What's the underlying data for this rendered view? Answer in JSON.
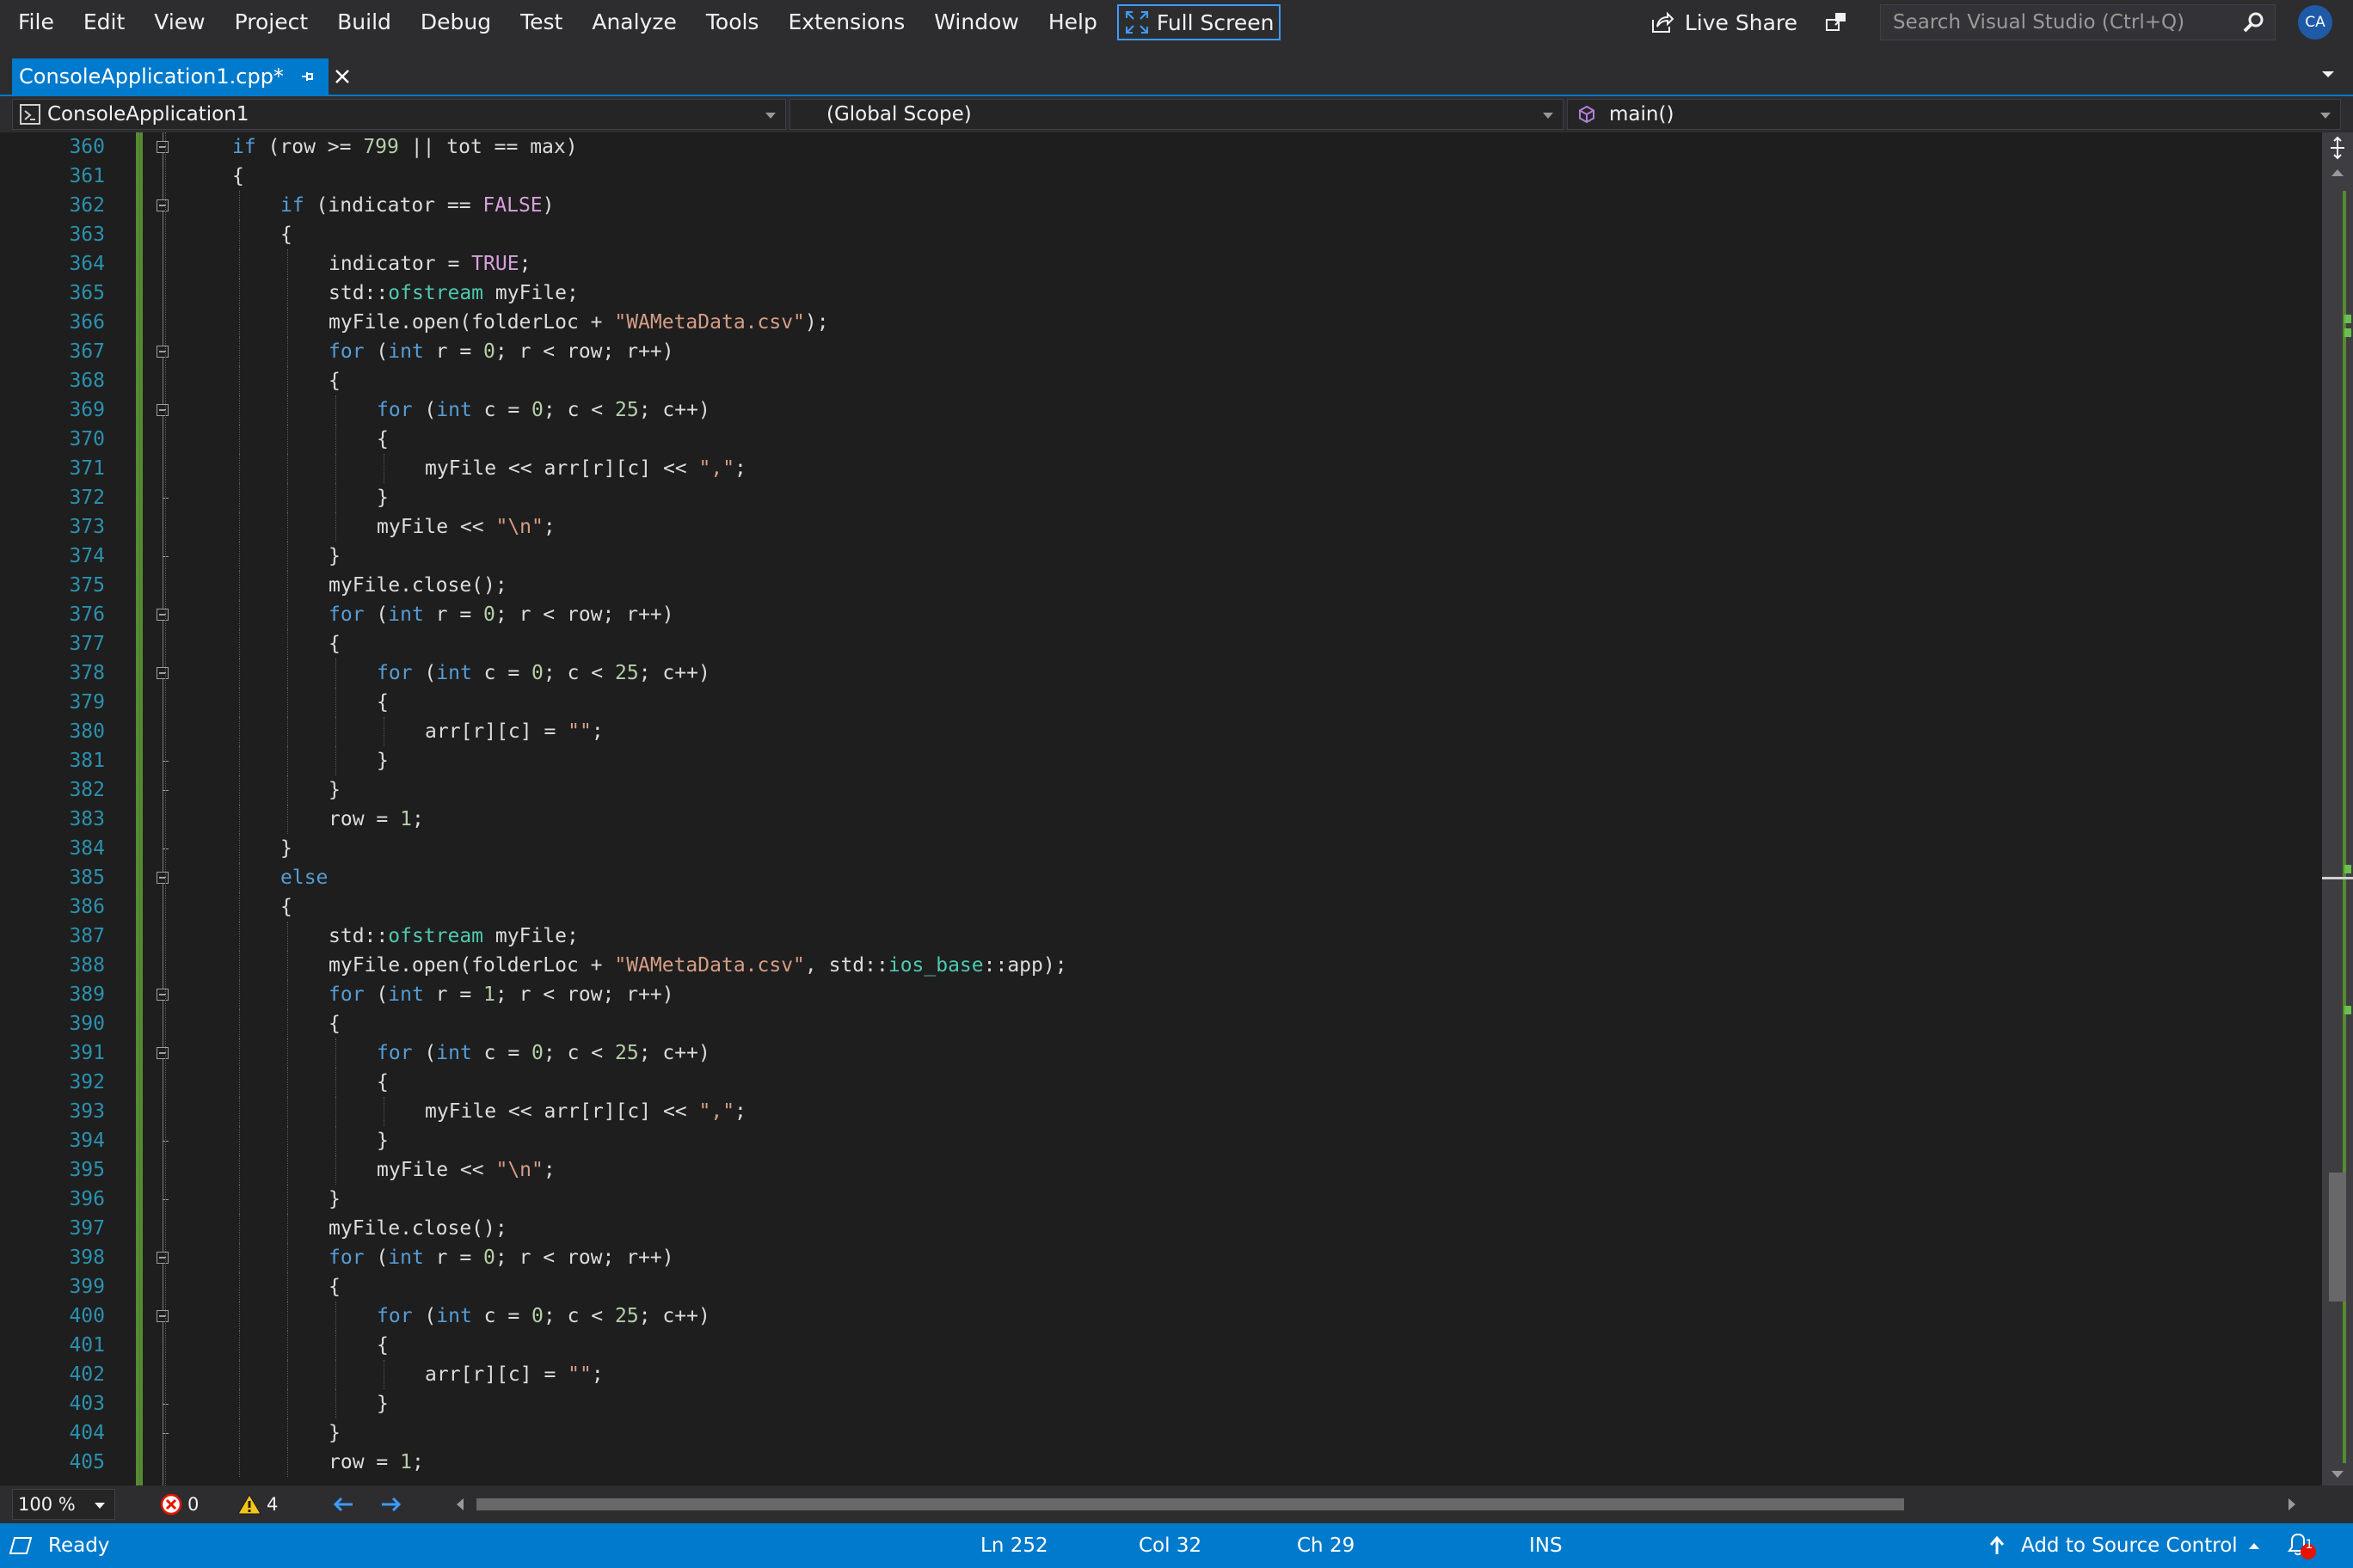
{
  "menu": {
    "items": [
      "File",
      "Edit",
      "View",
      "Project",
      "Build",
      "Debug",
      "Test",
      "Analyze",
      "Tools",
      "Extensions",
      "Window",
      "Help"
    ],
    "full_screen_label": "Full Screen"
  },
  "toolbar": {
    "live_share_label": "Live Share",
    "search_placeholder": "Search Visual Studio (Ctrl+Q)",
    "avatar_initials": "CA"
  },
  "tab": {
    "label": "ConsoleApplication1.cpp*"
  },
  "navbar": {
    "project": "ConsoleApplication1",
    "scope": "(Global Scope)",
    "member": "main()"
  },
  "editor": {
    "first_line": 360,
    "lines": [
      {
        "indent": 1,
        "tokens": [
          [
            "kw",
            "if"
          ],
          [
            "p",
            " (row >= "
          ],
          [
            "num",
            "799"
          ],
          [
            "p",
            " || tot == max)"
          ]
        ]
      },
      {
        "indent": 1,
        "tokens": [
          [
            "p",
            "{"
          ]
        ]
      },
      {
        "indent": 2,
        "tokens": [
          [
            "kw",
            "if"
          ],
          [
            "p",
            " (indicator == "
          ],
          [
            "mac",
            "FALSE"
          ],
          [
            "p",
            ")"
          ]
        ]
      },
      {
        "indent": 2,
        "tokens": [
          [
            "p",
            "{"
          ]
        ]
      },
      {
        "indent": 3,
        "tokens": [
          [
            "p",
            "indicator = "
          ],
          [
            "mac",
            "TRUE"
          ],
          [
            "p",
            ";"
          ]
        ]
      },
      {
        "indent": 3,
        "tokens": [
          [
            "p",
            "std::"
          ],
          [
            "typ",
            "ofstream"
          ],
          [
            "p",
            " myFile;"
          ]
        ]
      },
      {
        "indent": 3,
        "tokens": [
          [
            "p",
            "myFile.open(folderLoc + "
          ],
          [
            "str",
            "\"WAMetaData.csv\""
          ],
          [
            "p",
            ");"
          ]
        ]
      },
      {
        "indent": 3,
        "tokens": [
          [
            "kw",
            "for"
          ],
          [
            "p",
            " ("
          ],
          [
            "kw",
            "int"
          ],
          [
            "p",
            " r = "
          ],
          [
            "num",
            "0"
          ],
          [
            "p",
            "; r < row; r++)"
          ]
        ]
      },
      {
        "indent": 3,
        "tokens": [
          [
            "p",
            "{"
          ]
        ]
      },
      {
        "indent": 4,
        "tokens": [
          [
            "kw",
            "for"
          ],
          [
            "p",
            " ("
          ],
          [
            "kw",
            "int"
          ],
          [
            "p",
            " c = "
          ],
          [
            "num",
            "0"
          ],
          [
            "p",
            "; c < "
          ],
          [
            "num",
            "25"
          ],
          [
            "p",
            "; c++)"
          ]
        ]
      },
      {
        "indent": 4,
        "tokens": [
          [
            "p",
            "{"
          ]
        ]
      },
      {
        "indent": 5,
        "tokens": [
          [
            "p",
            "myFile << arr[r][c] << "
          ],
          [
            "str",
            "\",\""
          ],
          [
            "p",
            ";"
          ]
        ]
      },
      {
        "indent": 4,
        "tokens": [
          [
            "p",
            "}"
          ]
        ]
      },
      {
        "indent": 4,
        "tokens": [
          [
            "p",
            "myFile << "
          ],
          [
            "str",
            "\"\\n\""
          ],
          [
            "p",
            ";"
          ]
        ]
      },
      {
        "indent": 3,
        "tokens": [
          [
            "p",
            "}"
          ]
        ]
      },
      {
        "indent": 3,
        "tokens": [
          [
            "p",
            "myFile.close();"
          ]
        ]
      },
      {
        "indent": 3,
        "tokens": [
          [
            "kw",
            "for"
          ],
          [
            "p",
            " ("
          ],
          [
            "kw",
            "int"
          ],
          [
            "p",
            " r = "
          ],
          [
            "num",
            "0"
          ],
          [
            "p",
            "; r < row; r++)"
          ]
        ]
      },
      {
        "indent": 3,
        "tokens": [
          [
            "p",
            "{"
          ]
        ]
      },
      {
        "indent": 4,
        "tokens": [
          [
            "kw",
            "for"
          ],
          [
            "p",
            " ("
          ],
          [
            "kw",
            "int"
          ],
          [
            "p",
            " c = "
          ],
          [
            "num",
            "0"
          ],
          [
            "p",
            "; c < "
          ],
          [
            "num",
            "25"
          ],
          [
            "p",
            "; c++)"
          ]
        ]
      },
      {
        "indent": 4,
        "tokens": [
          [
            "p",
            "{"
          ]
        ]
      },
      {
        "indent": 5,
        "tokens": [
          [
            "p",
            "arr[r][c] = "
          ],
          [
            "str",
            "\"\""
          ],
          [
            "p",
            ";"
          ]
        ]
      },
      {
        "indent": 4,
        "tokens": [
          [
            "p",
            "}"
          ]
        ]
      },
      {
        "indent": 3,
        "tokens": [
          [
            "p",
            "}"
          ]
        ]
      },
      {
        "indent": 3,
        "tokens": [
          [
            "p",
            "row = "
          ],
          [
            "num",
            "1"
          ],
          [
            "p",
            ";"
          ]
        ]
      },
      {
        "indent": 2,
        "tokens": [
          [
            "p",
            "}"
          ]
        ]
      },
      {
        "indent": 2,
        "tokens": [
          [
            "kw",
            "else"
          ]
        ]
      },
      {
        "indent": 2,
        "tokens": [
          [
            "p",
            "{"
          ]
        ]
      },
      {
        "indent": 3,
        "tokens": [
          [
            "p",
            "std::"
          ],
          [
            "typ",
            "ofstream"
          ],
          [
            "p",
            " myFile;"
          ]
        ]
      },
      {
        "indent": 3,
        "tokens": [
          [
            "p",
            "myFile.open(folderLoc + "
          ],
          [
            "str",
            "\"WAMetaData.csv\""
          ],
          [
            "p",
            ", std::"
          ],
          [
            "typ",
            "ios_base"
          ],
          [
            "p",
            "::app);"
          ]
        ]
      },
      {
        "indent": 3,
        "tokens": [
          [
            "kw",
            "for"
          ],
          [
            "p",
            " ("
          ],
          [
            "kw",
            "int"
          ],
          [
            "p",
            " r = "
          ],
          [
            "num",
            "1"
          ],
          [
            "p",
            "; r < row; r++)"
          ]
        ]
      },
      {
        "indent": 3,
        "tokens": [
          [
            "p",
            "{"
          ]
        ]
      },
      {
        "indent": 4,
        "tokens": [
          [
            "kw",
            "for"
          ],
          [
            "p",
            " ("
          ],
          [
            "kw",
            "int"
          ],
          [
            "p",
            " c = "
          ],
          [
            "num",
            "0"
          ],
          [
            "p",
            "; c < "
          ],
          [
            "num",
            "25"
          ],
          [
            "p",
            "; c++)"
          ]
        ]
      },
      {
        "indent": 4,
        "tokens": [
          [
            "p",
            "{"
          ]
        ]
      },
      {
        "indent": 5,
        "tokens": [
          [
            "p",
            "myFile << arr[r][c] << "
          ],
          [
            "str",
            "\",\""
          ],
          [
            "p",
            ";"
          ]
        ]
      },
      {
        "indent": 4,
        "tokens": [
          [
            "p",
            "}"
          ]
        ]
      },
      {
        "indent": 4,
        "tokens": [
          [
            "p",
            "myFile << "
          ],
          [
            "str",
            "\"\\n\""
          ],
          [
            "p",
            ";"
          ]
        ]
      },
      {
        "indent": 3,
        "tokens": [
          [
            "p",
            "}"
          ]
        ]
      },
      {
        "indent": 3,
        "tokens": [
          [
            "p",
            "myFile.close();"
          ]
        ]
      },
      {
        "indent": 3,
        "tokens": [
          [
            "kw",
            "for"
          ],
          [
            "p",
            " ("
          ],
          [
            "kw",
            "int"
          ],
          [
            "p",
            " r = "
          ],
          [
            "num",
            "0"
          ],
          [
            "p",
            "; r < row; r++)"
          ]
        ]
      },
      {
        "indent": 3,
        "tokens": [
          [
            "p",
            "{"
          ]
        ]
      },
      {
        "indent": 4,
        "tokens": [
          [
            "kw",
            "for"
          ],
          [
            "p",
            " ("
          ],
          [
            "kw",
            "int"
          ],
          [
            "p",
            " c = "
          ],
          [
            "num",
            "0"
          ],
          [
            "p",
            "; c < "
          ],
          [
            "num",
            "25"
          ],
          [
            "p",
            "; c++)"
          ]
        ]
      },
      {
        "indent": 4,
        "tokens": [
          [
            "p",
            "{"
          ]
        ]
      },
      {
        "indent": 5,
        "tokens": [
          [
            "p",
            "arr[r][c] = "
          ],
          [
            "str",
            "\"\""
          ],
          [
            "p",
            ";"
          ]
        ]
      },
      {
        "indent": 4,
        "tokens": [
          [
            "p",
            "}"
          ]
        ]
      },
      {
        "indent": 3,
        "tokens": [
          [
            "p",
            "}"
          ]
        ]
      },
      {
        "indent": 3,
        "tokens": [
          [
            "p",
            "row = "
          ],
          [
            "num",
            "1"
          ],
          [
            "p",
            ";"
          ]
        ]
      }
    ],
    "fold_lines": [
      360,
      362,
      367,
      369,
      376,
      378,
      385,
      389,
      391,
      398,
      400
    ],
    "colors": {
      "keyword": "#569cd6",
      "string": "#d69d85",
      "number": "#b5cea8",
      "type": "#4ec9b0",
      "macro": "#d7a0dc",
      "plain": "#dcdcdc",
      "line_number": "#2b91af",
      "change_bar": "#548c2f"
    }
  },
  "info": {
    "zoom": "100 %",
    "errors": "0",
    "warnings": "4"
  },
  "status": {
    "ready": "Ready",
    "ln": "Ln 252",
    "col": "Col 32",
    "ch": "Ch 29",
    "ins": "INS",
    "source_control": "Add to Source Control",
    "notifications": "1"
  },
  "icons": [
    "full-screen-icon",
    "live-share-icon",
    "feedback-icon",
    "search-icon",
    "pin-icon",
    "close-icon",
    "chevron-down-icon",
    "project-icon",
    "method-icon",
    "error-icon",
    "warning-icon",
    "arrow-left-icon",
    "arrow-right-icon",
    "publish-icon",
    "bell-icon"
  ]
}
